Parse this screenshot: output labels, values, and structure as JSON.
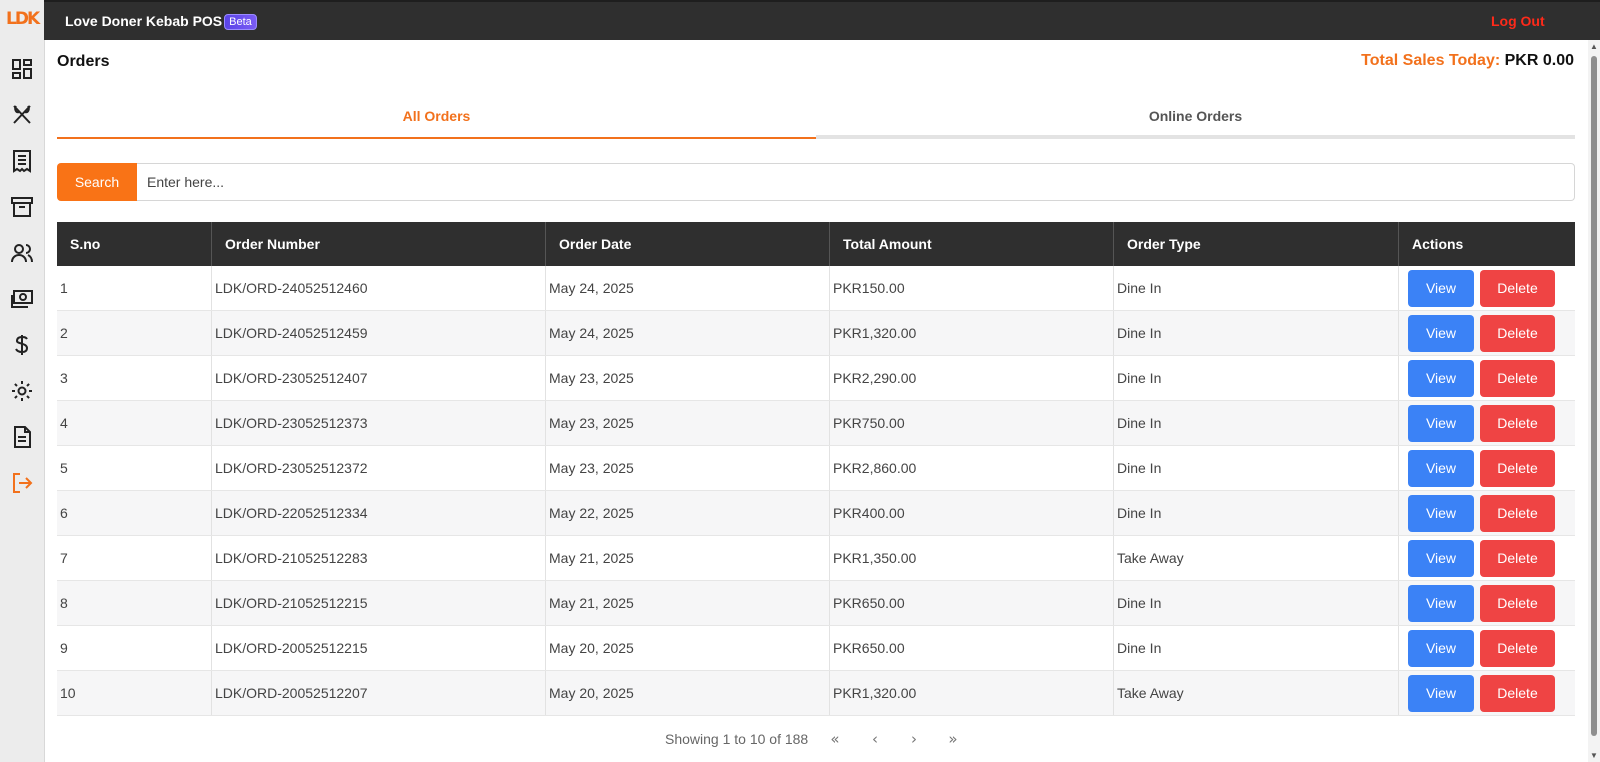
{
  "app": {
    "logo": "LDK",
    "title": "Love Doner Kebab POS",
    "badge": "Beta",
    "logout": "Log Out"
  },
  "sidebar": {
    "items": [
      {
        "name": "dashboard-icon"
      },
      {
        "name": "utensils-icon"
      },
      {
        "name": "receipt-icon"
      },
      {
        "name": "archive-icon"
      },
      {
        "name": "users-icon"
      },
      {
        "name": "money-icon"
      },
      {
        "name": "dollar-icon"
      },
      {
        "name": "gear-icon"
      },
      {
        "name": "document-icon"
      },
      {
        "name": "logout-icon"
      }
    ]
  },
  "page": {
    "title": "Orders",
    "sales_label": "Total Sales Today:",
    "sales_value": "PKR 0.00"
  },
  "tabs": [
    {
      "label": "All Orders"
    },
    {
      "label": "Online Orders"
    }
  ],
  "search": {
    "button": "Search",
    "placeholder": "Enter here..."
  },
  "table": {
    "headers": [
      "S.no",
      "Order Number",
      "Order Date",
      "Total Amount",
      "Order Type",
      "Actions"
    ],
    "view_label": "View",
    "delete_label": "Delete",
    "rows": [
      [
        "1",
        "LDK/ORD-24052512460",
        "May 24, 2025",
        "PKR150.00",
        "Dine In"
      ],
      [
        "2",
        "LDK/ORD-24052512459",
        "May 24, 2025",
        "PKR1,320.00",
        "Dine In"
      ],
      [
        "3",
        "LDK/ORD-23052512407",
        "May 23, 2025",
        "PKR2,290.00",
        "Dine In"
      ],
      [
        "4",
        "LDK/ORD-23052512373",
        "May 23, 2025",
        "PKR750.00",
        "Dine In"
      ],
      [
        "5",
        "LDK/ORD-23052512372",
        "May 23, 2025",
        "PKR2,860.00",
        "Dine In"
      ],
      [
        "6",
        "LDK/ORD-22052512334",
        "May 22, 2025",
        "PKR400.00",
        "Dine In"
      ],
      [
        "7",
        "LDK/ORD-21052512283",
        "May 21, 2025",
        "PKR1,350.00",
        "Take Away"
      ],
      [
        "8",
        "LDK/ORD-21052512215",
        "May 21, 2025",
        "PKR650.00",
        "Dine In"
      ],
      [
        "9",
        "LDK/ORD-20052512215",
        "May 20, 2025",
        "PKR650.00",
        "Dine In"
      ],
      [
        "10",
        "LDK/ORD-20052512207",
        "May 20, 2025",
        "PKR1,320.00",
        "Take Away"
      ]
    ]
  },
  "pagination": {
    "info": "Showing 1 to 10 of 188",
    "first": "«",
    "prev": "‹",
    "next": "›",
    "last": "»"
  },
  "colors": {
    "accent": "#f97316",
    "view": "#3b82f6",
    "delete": "#ef4444",
    "header": "#2f2f2f",
    "logout": "#ff2a1a"
  }
}
